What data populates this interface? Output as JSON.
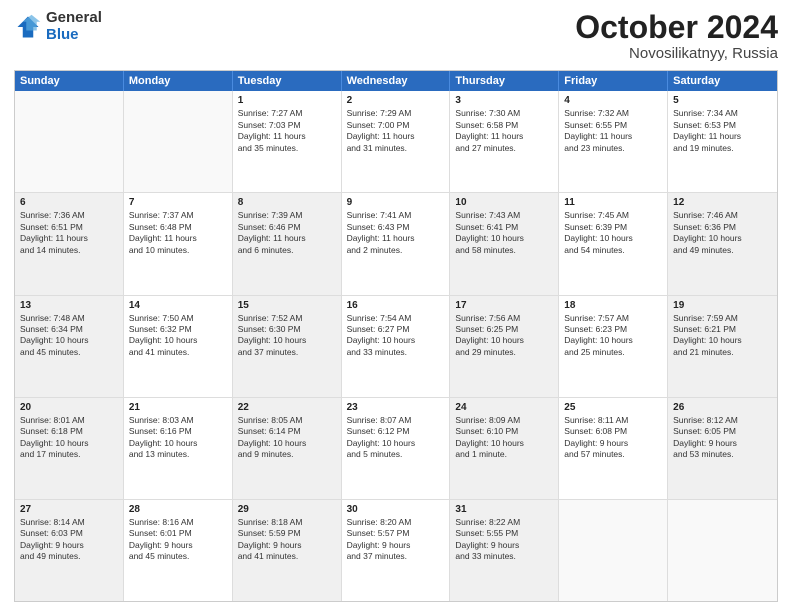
{
  "logo": {
    "general": "General",
    "blue": "Blue"
  },
  "title": {
    "month": "October 2024",
    "location": "Novosilikatnyy, Russia"
  },
  "header_days": [
    "Sunday",
    "Monday",
    "Tuesday",
    "Wednesday",
    "Thursday",
    "Friday",
    "Saturday"
  ],
  "rows": [
    [
      {
        "day": "",
        "lines": [],
        "empty": true
      },
      {
        "day": "",
        "lines": [],
        "empty": true
      },
      {
        "day": "1",
        "lines": [
          "Sunrise: 7:27 AM",
          "Sunset: 7:03 PM",
          "Daylight: 11 hours",
          "and 35 minutes."
        ],
        "empty": false
      },
      {
        "day": "2",
        "lines": [
          "Sunrise: 7:29 AM",
          "Sunset: 7:00 PM",
          "Daylight: 11 hours",
          "and 31 minutes."
        ],
        "empty": false
      },
      {
        "day": "3",
        "lines": [
          "Sunrise: 7:30 AM",
          "Sunset: 6:58 PM",
          "Daylight: 11 hours",
          "and 27 minutes."
        ],
        "empty": false
      },
      {
        "day": "4",
        "lines": [
          "Sunrise: 7:32 AM",
          "Sunset: 6:55 PM",
          "Daylight: 11 hours",
          "and 23 minutes."
        ],
        "empty": false
      },
      {
        "day": "5",
        "lines": [
          "Sunrise: 7:34 AM",
          "Sunset: 6:53 PM",
          "Daylight: 11 hours",
          "and 19 minutes."
        ],
        "empty": false
      }
    ],
    [
      {
        "day": "6",
        "lines": [
          "Sunrise: 7:36 AM",
          "Sunset: 6:51 PM",
          "Daylight: 11 hours",
          "and 14 minutes."
        ],
        "empty": false,
        "shaded": true
      },
      {
        "day": "7",
        "lines": [
          "Sunrise: 7:37 AM",
          "Sunset: 6:48 PM",
          "Daylight: 11 hours",
          "and 10 minutes."
        ],
        "empty": false,
        "shaded": false
      },
      {
        "day": "8",
        "lines": [
          "Sunrise: 7:39 AM",
          "Sunset: 6:46 PM",
          "Daylight: 11 hours",
          "and 6 minutes."
        ],
        "empty": false,
        "shaded": true
      },
      {
        "day": "9",
        "lines": [
          "Sunrise: 7:41 AM",
          "Sunset: 6:43 PM",
          "Daylight: 11 hours",
          "and 2 minutes."
        ],
        "empty": false,
        "shaded": false
      },
      {
        "day": "10",
        "lines": [
          "Sunrise: 7:43 AM",
          "Sunset: 6:41 PM",
          "Daylight: 10 hours",
          "and 58 minutes."
        ],
        "empty": false,
        "shaded": true
      },
      {
        "day": "11",
        "lines": [
          "Sunrise: 7:45 AM",
          "Sunset: 6:39 PM",
          "Daylight: 10 hours",
          "and 54 minutes."
        ],
        "empty": false,
        "shaded": false
      },
      {
        "day": "12",
        "lines": [
          "Sunrise: 7:46 AM",
          "Sunset: 6:36 PM",
          "Daylight: 10 hours",
          "and 49 minutes."
        ],
        "empty": false,
        "shaded": true
      }
    ],
    [
      {
        "day": "13",
        "lines": [
          "Sunrise: 7:48 AM",
          "Sunset: 6:34 PM",
          "Daylight: 10 hours",
          "and 45 minutes."
        ],
        "empty": false,
        "shaded": true
      },
      {
        "day": "14",
        "lines": [
          "Sunrise: 7:50 AM",
          "Sunset: 6:32 PM",
          "Daylight: 10 hours",
          "and 41 minutes."
        ],
        "empty": false,
        "shaded": false
      },
      {
        "day": "15",
        "lines": [
          "Sunrise: 7:52 AM",
          "Sunset: 6:30 PM",
          "Daylight: 10 hours",
          "and 37 minutes."
        ],
        "empty": false,
        "shaded": true
      },
      {
        "day": "16",
        "lines": [
          "Sunrise: 7:54 AM",
          "Sunset: 6:27 PM",
          "Daylight: 10 hours",
          "and 33 minutes."
        ],
        "empty": false,
        "shaded": false
      },
      {
        "day": "17",
        "lines": [
          "Sunrise: 7:56 AM",
          "Sunset: 6:25 PM",
          "Daylight: 10 hours",
          "and 29 minutes."
        ],
        "empty": false,
        "shaded": true
      },
      {
        "day": "18",
        "lines": [
          "Sunrise: 7:57 AM",
          "Sunset: 6:23 PM",
          "Daylight: 10 hours",
          "and 25 minutes."
        ],
        "empty": false,
        "shaded": false
      },
      {
        "day": "19",
        "lines": [
          "Sunrise: 7:59 AM",
          "Sunset: 6:21 PM",
          "Daylight: 10 hours",
          "and 21 minutes."
        ],
        "empty": false,
        "shaded": true
      }
    ],
    [
      {
        "day": "20",
        "lines": [
          "Sunrise: 8:01 AM",
          "Sunset: 6:18 PM",
          "Daylight: 10 hours",
          "and 17 minutes."
        ],
        "empty": false,
        "shaded": true
      },
      {
        "day": "21",
        "lines": [
          "Sunrise: 8:03 AM",
          "Sunset: 6:16 PM",
          "Daylight: 10 hours",
          "and 13 minutes."
        ],
        "empty": false,
        "shaded": false
      },
      {
        "day": "22",
        "lines": [
          "Sunrise: 8:05 AM",
          "Sunset: 6:14 PM",
          "Daylight: 10 hours",
          "and 9 minutes."
        ],
        "empty": false,
        "shaded": true
      },
      {
        "day": "23",
        "lines": [
          "Sunrise: 8:07 AM",
          "Sunset: 6:12 PM",
          "Daylight: 10 hours",
          "and 5 minutes."
        ],
        "empty": false,
        "shaded": false
      },
      {
        "day": "24",
        "lines": [
          "Sunrise: 8:09 AM",
          "Sunset: 6:10 PM",
          "Daylight: 10 hours",
          "and 1 minute."
        ],
        "empty": false,
        "shaded": true
      },
      {
        "day": "25",
        "lines": [
          "Sunrise: 8:11 AM",
          "Sunset: 6:08 PM",
          "Daylight: 9 hours",
          "and 57 minutes."
        ],
        "empty": false,
        "shaded": false
      },
      {
        "day": "26",
        "lines": [
          "Sunrise: 8:12 AM",
          "Sunset: 6:05 PM",
          "Daylight: 9 hours",
          "and 53 minutes."
        ],
        "empty": false,
        "shaded": true
      }
    ],
    [
      {
        "day": "27",
        "lines": [
          "Sunrise: 8:14 AM",
          "Sunset: 6:03 PM",
          "Daylight: 9 hours",
          "and 49 minutes."
        ],
        "empty": false,
        "shaded": true
      },
      {
        "day": "28",
        "lines": [
          "Sunrise: 8:16 AM",
          "Sunset: 6:01 PM",
          "Daylight: 9 hours",
          "and 45 minutes."
        ],
        "empty": false,
        "shaded": false
      },
      {
        "day": "29",
        "lines": [
          "Sunrise: 8:18 AM",
          "Sunset: 5:59 PM",
          "Daylight: 9 hours",
          "and 41 minutes."
        ],
        "empty": false,
        "shaded": true
      },
      {
        "day": "30",
        "lines": [
          "Sunrise: 8:20 AM",
          "Sunset: 5:57 PM",
          "Daylight: 9 hours",
          "and 37 minutes."
        ],
        "empty": false,
        "shaded": false
      },
      {
        "day": "31",
        "lines": [
          "Sunrise: 8:22 AM",
          "Sunset: 5:55 PM",
          "Daylight: 9 hours",
          "and 33 minutes."
        ],
        "empty": false,
        "shaded": true
      },
      {
        "day": "",
        "lines": [],
        "empty": true
      },
      {
        "day": "",
        "lines": [],
        "empty": true
      }
    ]
  ]
}
